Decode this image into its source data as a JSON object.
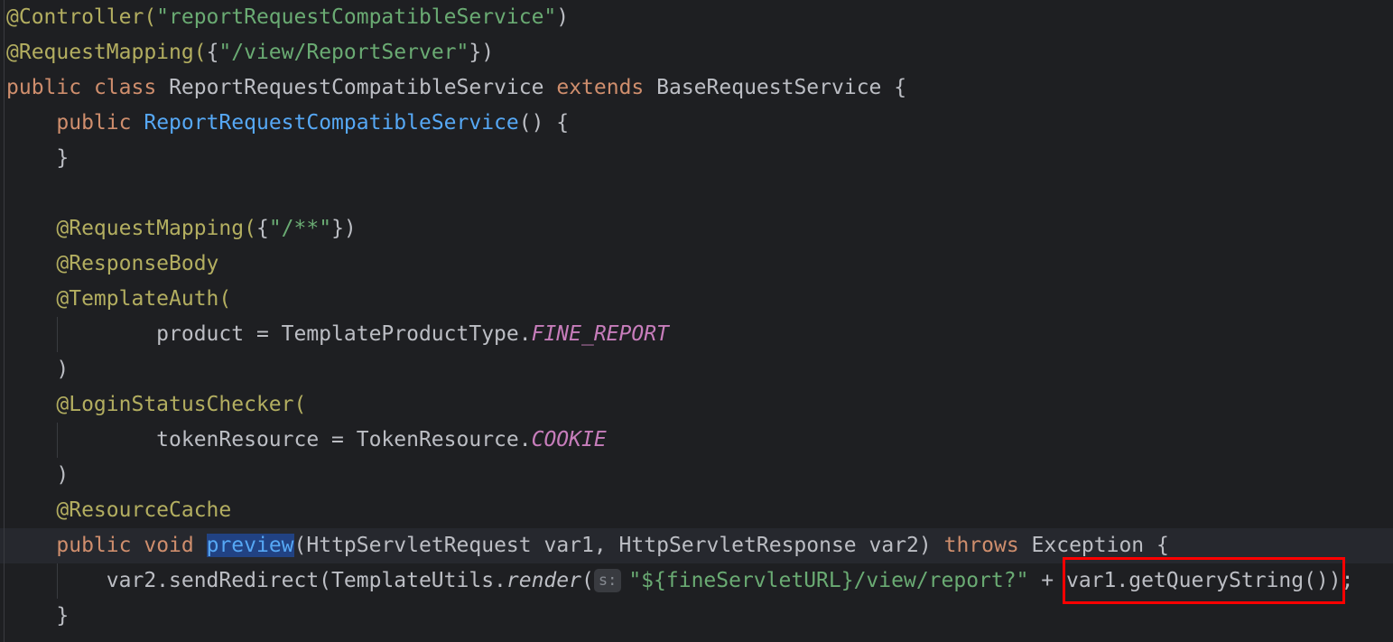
{
  "code": {
    "controller_ann": "@Controller(",
    "controller_arg": "\"reportRequestCompatibleService\"",
    "controller_close": ")",
    "mapping_ann": "@RequestMapping(",
    "mapping_open": "{",
    "mapping_arg": "\"/view/ReportServer\"",
    "mapping_close": "})",
    "public_kw": "public",
    "class_kw": "class",
    "class_name": "ReportRequestCompatibleService",
    "extends_kw": "extends",
    "base_class": "BaseRequestService {",
    "ctor_public": "public",
    "ctor_name": "ReportRequestCompatibleService",
    "ctor_rest": "() {",
    "ctor_close": "}",
    "mapping2_ann": "@RequestMapping(",
    "mapping2_open": "{",
    "mapping2_arg": "\"/**\"",
    "mapping2_close": "})",
    "response_body": "@ResponseBody",
    "template_auth": "@TemplateAuth(",
    "product_assign": "product = TemplateProductType.",
    "product_const": "FINE_REPORT",
    "paren_close_1": ")",
    "login_checker": "@LoginStatusChecker(",
    "token_assign": "tokenResource = TokenResource.",
    "token_const": "COOKIE",
    "paren_close_2": ")",
    "resource_cache": "@ResourceCache",
    "method_public": "public",
    "method_void": "void",
    "method_name": "preview",
    "method_params": "(HttpServletRequest var1, HttpServletResponse var2) ",
    "throws_kw": "throws",
    "method_exc": " Exception {",
    "redirect_call": "var2.sendRedirect(TemplateUtils.",
    "render_call": "render",
    "render_paren": "(",
    "param_hint": "s:",
    "redirect_str": "\"${fineServletURL}/view/report?\"",
    "redirect_plus": " + ",
    "query_call": "var1.getQueryString()",
    "redirect_end": ");",
    "method_close": "}"
  }
}
